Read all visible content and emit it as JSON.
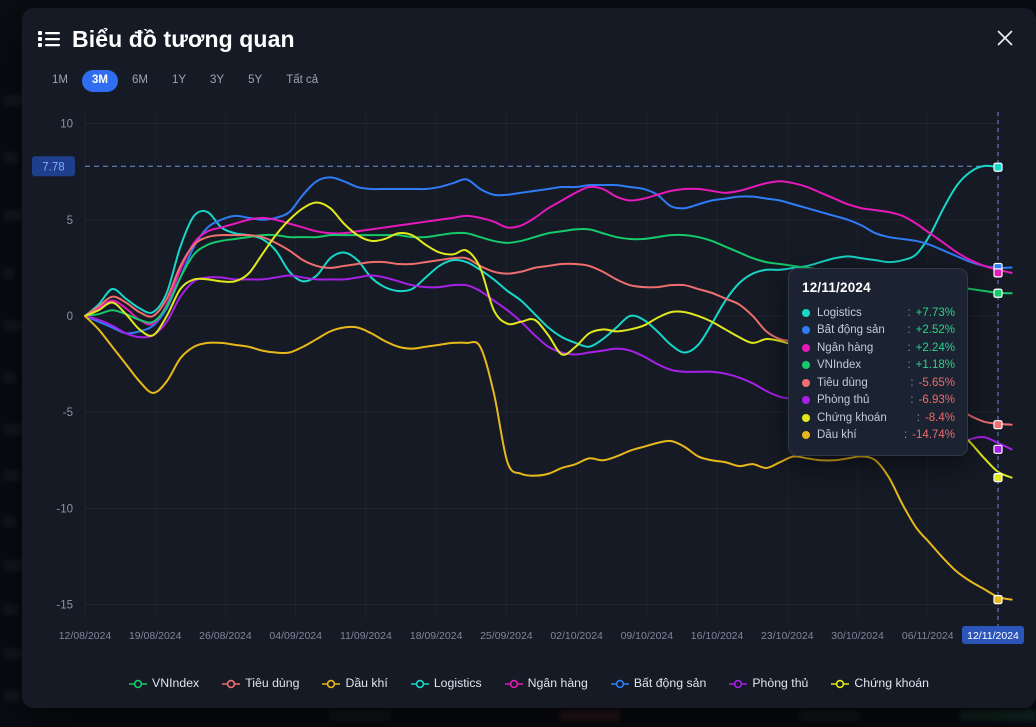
{
  "header": {
    "title": "Biểu đồ tương quan",
    "list_icon": "list-icon",
    "close_icon": "close-icon"
  },
  "range_buttons": [
    {
      "label": "1M",
      "active": false
    },
    {
      "label": "3M",
      "active": true
    },
    {
      "label": "6M",
      "active": false
    },
    {
      "label": "1Y",
      "active": false
    },
    {
      "label": "3Y",
      "active": false
    },
    {
      "label": "5Y",
      "active": false
    },
    {
      "label": "Tất cả",
      "active": false
    }
  ],
  "tooltip": {
    "date": "12/11/2024",
    "rows": [
      {
        "name": "Logistics",
        "value": "+7.73%",
        "color": "#17d7c8",
        "dir": "up"
      },
      {
        "name": "Bất động sản",
        "value": "+2.52%",
        "color": "#2f7cf6",
        "dir": "up"
      },
      {
        "name": "Ngân hàng",
        "value": "+2.24%",
        "color": "#e619ba",
        "dir": "up"
      },
      {
        "name": "VNIndex",
        "value": "+1.18%",
        "color": "#16c96b",
        "dir": "up"
      },
      {
        "name": "Tiêu dùng",
        "value": "-5.65%",
        "color": "#ef6f6f",
        "dir": "down"
      },
      {
        "name": "Phòng thủ",
        "value": "-6.93%",
        "color": "#a820e8",
        "dir": "down"
      },
      {
        "name": "Chứng khoán",
        "value": "-8.4%",
        "color": "#e1e81b",
        "dir": "down"
      },
      {
        "name": "Dầu khí",
        "value": "-14.74%",
        "color": "#e8b81b",
        "dir": "down"
      }
    ]
  },
  "axis": {
    "y_ticks": [
      "10",
      "5",
      "0",
      "-5",
      "-10",
      "-15"
    ],
    "y_values": [
      10,
      5,
      0,
      -5,
      -10,
      -15
    ],
    "marker_label": "7.78",
    "marker_value": 7.78,
    "x_ticks": [
      "12/08/2024",
      "19/08/2024",
      "26/08/2024",
      "04/09/2024",
      "11/09/2024",
      "18/09/2024",
      "25/09/2024",
      "02/10/2024",
      "09/10/2024",
      "16/10/2024",
      "23/10/2024",
      "30/10/2024",
      "06/11/2024",
      "12/11/2024"
    ],
    "x_highlight": "12/11/2024"
  },
  "legend": [
    {
      "label": "VNIndex",
      "color": "#16c96b"
    },
    {
      "label": "Tiêu dùng",
      "color": "#ef6f6f"
    },
    {
      "label": "Dầu khí",
      "color": "#e8b81b"
    },
    {
      "label": "Logistics",
      "color": "#17d7c8"
    },
    {
      "label": "Ngân hàng",
      "color": "#e619ba"
    },
    {
      "label": "Bất động sản",
      "color": "#2f7cf6"
    },
    {
      "label": "Phòng thủ",
      "color": "#a820e8"
    },
    {
      "label": "Chứng khoán",
      "color": "#e1e81b"
    }
  ],
  "chart_data": {
    "type": "line",
    "title": "Biểu đồ tương quan",
    "xlabel": "",
    "ylabel": "%",
    "ylim": [
      -15.8,
      10.6
    ],
    "grid": true,
    "legend_position": "bottom",
    "x_tick_labels": [
      "12/08/2024",
      "19/08/2024",
      "26/08/2024",
      "04/09/2024",
      "11/09/2024",
      "18/09/2024",
      "25/09/2024",
      "02/10/2024",
      "09/10/2024",
      "16/10/2024",
      "23/10/2024",
      "30/10/2024",
      "06/11/2024",
      "12/11/2024"
    ],
    "highlight": {
      "date": "12/11/2024",
      "value": 7.78,
      "label": "7.78"
    },
    "series": [
      {
        "name": "Logistics",
        "color": "#17d7c8",
        "final_value": 7.73,
        "values": [
          0,
          0.6,
          1.4,
          0.9,
          0.4,
          0.2,
          1.2,
          3.6,
          5.2,
          5.4,
          4.6,
          4.3,
          4.2,
          4.0,
          3.4,
          2.3,
          1.8,
          2.1,
          3.0,
          3.3,
          2.9,
          2.0,
          1.5,
          1.3,
          1.4,
          2.0,
          2.6,
          2.9,
          2.8,
          2.4,
          1.9,
          1.3,
          0.8,
          0.1,
          -0.6,
          -1.1,
          -1.4,
          -1.6,
          -1.2,
          -0.6,
          0.0,
          -0.2,
          -0.8,
          -1.5,
          -1.9,
          -1.5,
          -0.4,
          0.8,
          1.7,
          2.2,
          2.4,
          2.4,
          2.5,
          2.6,
          2.8,
          3.0,
          3.1,
          3.0,
          2.9,
          2.8,
          2.9,
          3.2,
          4.2,
          5.6,
          6.8,
          7.5,
          7.8,
          7.73
        ]
      },
      {
        "name": "Bất động sản",
        "color": "#2f7cf6",
        "final_value": 2.52,
        "values": [
          0,
          -0.3,
          -0.6,
          -0.9,
          -0.8,
          -0.5,
          0.4,
          2.0,
          3.6,
          4.6,
          5.0,
          5.2,
          5.1,
          5.0,
          5.1,
          5.4,
          6.3,
          7.0,
          7.2,
          7.0,
          6.7,
          6.6,
          6.6,
          6.6,
          6.6,
          6.6,
          6.7,
          6.9,
          7.1,
          6.6,
          6.3,
          6.3,
          6.4,
          6.5,
          6.6,
          6.7,
          6.7,
          6.8,
          6.8,
          6.8,
          6.7,
          6.6,
          6.3,
          5.7,
          5.6,
          5.8,
          6.0,
          6.1,
          6.2,
          6.2,
          6.1,
          6.0,
          5.8,
          5.6,
          5.4,
          5.2,
          5.0,
          4.7,
          4.3,
          4.1,
          4.0,
          3.9,
          3.7,
          3.4,
          3.1,
          2.8,
          2.6,
          2.5,
          2.52
        ]
      },
      {
        "name": "Ngân hàng",
        "color": "#e619ba",
        "final_value": 2.24,
        "values": [
          0,
          0.4,
          0.8,
          0.4,
          -0.2,
          -0.4,
          0.6,
          2.4,
          3.8,
          4.4,
          4.6,
          4.8,
          5.0,
          5.1,
          5.0,
          4.8,
          4.6,
          4.4,
          4.3,
          4.3,
          4.4,
          4.5,
          4.6,
          4.7,
          4.8,
          4.9,
          5.0,
          5.1,
          5.2,
          5.1,
          4.9,
          4.6,
          4.7,
          5.1,
          5.6,
          6.0,
          6.4,
          6.7,
          6.6,
          6.2,
          6.0,
          6.1,
          6.3,
          6.5,
          6.6,
          6.6,
          6.5,
          6.4,
          6.5,
          6.7,
          6.9,
          7.0,
          6.9,
          6.7,
          6.4,
          6.1,
          5.8,
          5.6,
          5.5,
          5.4,
          5.2,
          4.8,
          4.3,
          3.8,
          3.3,
          2.9,
          2.6,
          2.4,
          2.24
        ]
      },
      {
        "name": "VNIndex",
        "color": "#16c96b",
        "final_value": 1.18,
        "values": [
          0,
          0.1,
          0.3,
          0.1,
          -0.2,
          -0.3,
          0.5,
          2.0,
          3.2,
          3.7,
          3.9,
          4.0,
          4.1,
          4.2,
          4.2,
          4.1,
          4.1,
          4.1,
          4.2,
          4.2,
          4.2,
          4.2,
          4.2,
          4.2,
          4.1,
          4.1,
          4.2,
          4.3,
          4.3,
          4.1,
          3.9,
          3.8,
          3.9,
          4.1,
          4.3,
          4.4,
          4.5,
          4.5,
          4.3,
          4.1,
          4.0,
          4.0,
          4.1,
          4.2,
          4.2,
          4.1,
          3.9,
          3.6,
          3.3,
          3.0,
          2.8,
          2.7,
          2.6,
          2.5,
          2.4,
          2.3,
          2.2,
          2.1,
          2.0,
          1.9,
          1.9,
          1.8,
          1.7,
          1.6,
          1.5,
          1.4,
          1.3,
          1.2,
          1.18
        ]
      },
      {
        "name": "Tiêu dùng",
        "color": "#ef6f6f",
        "final_value": -5.65,
        "values": [
          0,
          0.5,
          1.0,
          0.7,
          0.2,
          0.0,
          0.9,
          2.6,
          3.7,
          4.1,
          4.2,
          4.2,
          4.2,
          4.1,
          3.8,
          3.4,
          2.9,
          2.6,
          2.5,
          2.6,
          2.7,
          2.8,
          2.8,
          2.7,
          2.7,
          2.8,
          2.9,
          3.0,
          3.0,
          2.6,
          2.3,
          2.2,
          2.3,
          2.5,
          2.6,
          2.7,
          2.7,
          2.6,
          2.3,
          1.9,
          1.6,
          1.5,
          1.5,
          1.6,
          1.6,
          1.4,
          1.2,
          0.9,
          0.6,
          0.0,
          -0.8,
          -1.2,
          -1.3,
          -1.3,
          -1.4,
          -1.5,
          -1.7,
          -1.9,
          -2.2,
          -2.6,
          -3.1,
          -3.5,
          -3.9,
          -4.3,
          -4.8,
          -5.2,
          -5.5,
          -5.6,
          -5.65
        ]
      },
      {
        "name": "Phòng thủ",
        "color": "#a820e8",
        "final_value": -6.93,
        "values": [
          0,
          -0.2,
          -0.5,
          -0.9,
          -1.1,
          -1.0,
          -0.3,
          1.0,
          1.8,
          2.0,
          2.0,
          1.9,
          1.9,
          1.9,
          2.0,
          2.1,
          2.0,
          1.9,
          1.9,
          1.9,
          2.0,
          2.1,
          2.0,
          1.8,
          1.6,
          1.5,
          1.5,
          1.6,
          1.6,
          1.3,
          0.8,
          0.3,
          -0.3,
          -1.0,
          -1.6,
          -1.9,
          -2.0,
          -1.9,
          -1.8,
          -1.7,
          -1.8,
          -2.1,
          -2.5,
          -2.8,
          -2.9,
          -2.9,
          -2.9,
          -3.0,
          -3.2,
          -3.5,
          -3.9,
          -4.2,
          -4.3,
          -4.3,
          -4.2,
          -4.0,
          -3.8,
          -3.7,
          -4.2,
          -5.1,
          -6.0,
          -6.6,
          -6.9,
          -7.0,
          -6.8,
          -6.4,
          -6.3,
          -6.6,
          -6.93
        ]
      },
      {
        "name": "Chứng khoán",
        "color": "#e1e81b",
        "final_value": -8.4,
        "values": [
          0,
          0.3,
          0.7,
          0.1,
          -0.7,
          -1.0,
          0.0,
          1.4,
          1.9,
          1.9,
          1.8,
          1.8,
          2.2,
          3.2,
          4.2,
          5.0,
          5.6,
          5.9,
          5.6,
          4.8,
          4.2,
          3.9,
          4.0,
          4.3,
          4.2,
          3.7,
          3.3,
          3.2,
          3.4,
          2.5,
          0.3,
          -0.4,
          -0.3,
          -0.2,
          -1.0,
          -2.0,
          -1.6,
          -0.9,
          -0.7,
          -0.8,
          -0.7,
          -0.5,
          -0.1,
          0.2,
          0.2,
          0.0,
          -0.3,
          -0.7,
          -1.1,
          -1.4,
          -1.2,
          -1.3,
          -1.5,
          -1.6,
          -1.5,
          -1.3,
          -1.4,
          -1.6,
          -1.6,
          -1.4,
          -2.2,
          -3.6,
          -4.7,
          -5.3,
          -5.9,
          -6.6,
          -7.4,
          -8.1,
          -8.4
        ]
      },
      {
        "name": "Dầu khí",
        "color": "#e8b81b",
        "final_value": -14.74,
        "values": [
          0,
          -0.7,
          -1.6,
          -2.5,
          -3.4,
          -4.0,
          -3.4,
          -2.2,
          -1.6,
          -1.4,
          -1.4,
          -1.5,
          -1.6,
          -1.8,
          -1.9,
          -1.9,
          -1.6,
          -1.2,
          -0.8,
          -0.6,
          -0.6,
          -0.9,
          -1.3,
          -1.6,
          -1.7,
          -1.6,
          -1.5,
          -1.4,
          -1.4,
          -1.6,
          -4.0,
          -7.6,
          -8.2,
          -8.3,
          -8.2,
          -7.9,
          -7.7,
          -7.4,
          -7.5,
          -7.3,
          -7.0,
          -6.8,
          -6.6,
          -6.5,
          -6.8,
          -7.3,
          -7.5,
          -7.6,
          -7.8,
          -7.7,
          -7.9,
          -7.6,
          -7.3,
          -7.4,
          -7.5,
          -7.5,
          -7.4,
          -7.3,
          -7.5,
          -8.4,
          -9.8,
          -11.0,
          -11.8,
          -12.6,
          -13.3,
          -13.8,
          -14.2,
          -14.6,
          -14.74
        ]
      }
    ]
  }
}
